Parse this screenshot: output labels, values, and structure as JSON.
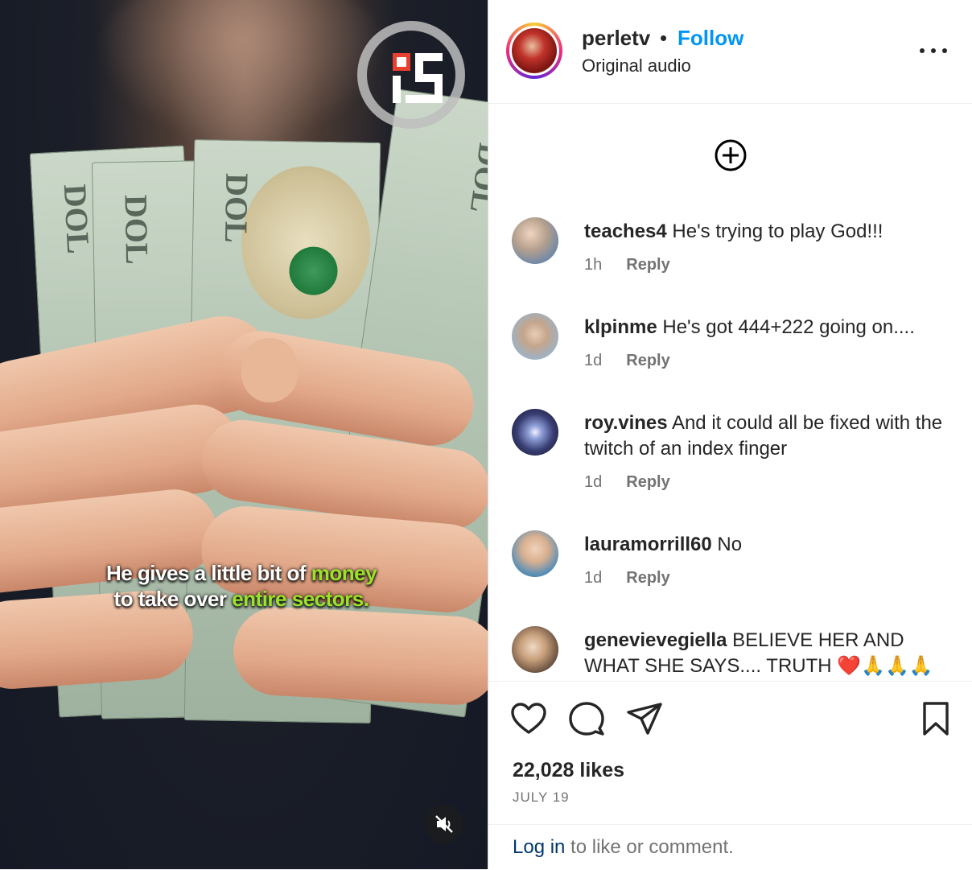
{
  "post": {
    "username": "perletv",
    "separator": "•",
    "follow_label": "Follow",
    "audio_label": "Original audio",
    "video_caption_line1_a": "He gives a little bit of ",
    "video_caption_line1_b": "money",
    "video_caption_line2_a": "to take over ",
    "video_caption_line2_b": "entire sectors.",
    "caption_highlight_color": "#9be22a",
    "bill_text": "DOL"
  },
  "comments": [
    {
      "user": "teaches4",
      "text": "He's trying to play God!!!",
      "time": "1h",
      "reply": "Reply"
    },
    {
      "user": "klpinme",
      "text": "He's got 444+222 going on....",
      "time": "1d",
      "reply": "Reply"
    },
    {
      "user": "roy.vines",
      "text": "And it could all be fixed with the twitch of an index finger",
      "time": "1d",
      "reply": "Reply"
    },
    {
      "user": "lauramorrill60",
      "text": "No",
      "time": "1d",
      "reply": "Reply"
    },
    {
      "user": "genevievegiella",
      "text": "BELIEVE HER AND WHAT SHE SAYS.... TRUTH ❤️🙏🙏🙏🙏",
      "time": "",
      "reply": ""
    }
  ],
  "footer": {
    "likes": "22,028 likes",
    "date": "JULY 19",
    "login_link": "Log in",
    "login_rest": " to like or comment."
  },
  "colors": {
    "accent": "#0095f6",
    "link_dark": "#00376b",
    "muted": "#737373"
  },
  "icons": [
    "more-options-icon",
    "add-comment-icon",
    "heart-icon",
    "comment-icon",
    "share-icon",
    "bookmark-icon",
    "mute-icon",
    "channel-logo-icon"
  ]
}
